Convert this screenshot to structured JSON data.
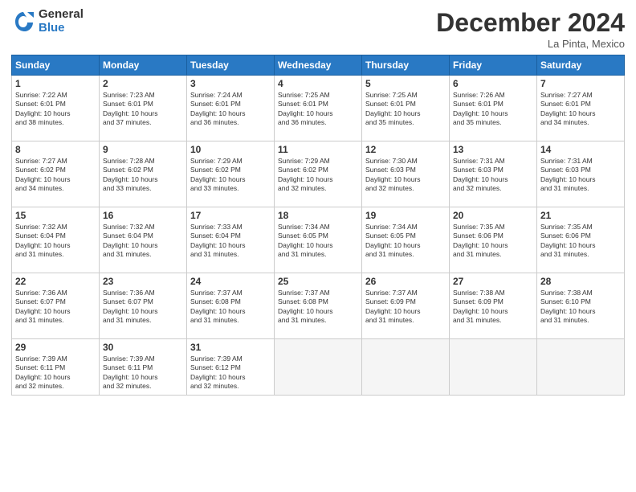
{
  "logo": {
    "general": "General",
    "blue": "Blue"
  },
  "title": "December 2024",
  "location": "La Pinta, Mexico",
  "weekdays": [
    "Sunday",
    "Monday",
    "Tuesday",
    "Wednesday",
    "Thursday",
    "Friday",
    "Saturday"
  ],
  "weeks": [
    [
      {
        "day": "1",
        "info": "Sunrise: 7:22 AM\nSunset: 6:01 PM\nDaylight: 10 hours\nand 38 minutes."
      },
      {
        "day": "2",
        "info": "Sunrise: 7:23 AM\nSunset: 6:01 PM\nDaylight: 10 hours\nand 37 minutes."
      },
      {
        "day": "3",
        "info": "Sunrise: 7:24 AM\nSunset: 6:01 PM\nDaylight: 10 hours\nand 36 minutes."
      },
      {
        "day": "4",
        "info": "Sunrise: 7:25 AM\nSunset: 6:01 PM\nDaylight: 10 hours\nand 36 minutes."
      },
      {
        "day": "5",
        "info": "Sunrise: 7:25 AM\nSunset: 6:01 PM\nDaylight: 10 hours\nand 35 minutes."
      },
      {
        "day": "6",
        "info": "Sunrise: 7:26 AM\nSunset: 6:01 PM\nDaylight: 10 hours\nand 35 minutes."
      },
      {
        "day": "7",
        "info": "Sunrise: 7:27 AM\nSunset: 6:01 PM\nDaylight: 10 hours\nand 34 minutes."
      }
    ],
    [
      {
        "day": "8",
        "info": "Sunrise: 7:27 AM\nSunset: 6:02 PM\nDaylight: 10 hours\nand 34 minutes."
      },
      {
        "day": "9",
        "info": "Sunrise: 7:28 AM\nSunset: 6:02 PM\nDaylight: 10 hours\nand 33 minutes."
      },
      {
        "day": "10",
        "info": "Sunrise: 7:29 AM\nSunset: 6:02 PM\nDaylight: 10 hours\nand 33 minutes."
      },
      {
        "day": "11",
        "info": "Sunrise: 7:29 AM\nSunset: 6:02 PM\nDaylight: 10 hours\nand 32 minutes."
      },
      {
        "day": "12",
        "info": "Sunrise: 7:30 AM\nSunset: 6:03 PM\nDaylight: 10 hours\nand 32 minutes."
      },
      {
        "day": "13",
        "info": "Sunrise: 7:31 AM\nSunset: 6:03 PM\nDaylight: 10 hours\nand 32 minutes."
      },
      {
        "day": "14",
        "info": "Sunrise: 7:31 AM\nSunset: 6:03 PM\nDaylight: 10 hours\nand 31 minutes."
      }
    ],
    [
      {
        "day": "15",
        "info": "Sunrise: 7:32 AM\nSunset: 6:04 PM\nDaylight: 10 hours\nand 31 minutes."
      },
      {
        "day": "16",
        "info": "Sunrise: 7:32 AM\nSunset: 6:04 PM\nDaylight: 10 hours\nand 31 minutes."
      },
      {
        "day": "17",
        "info": "Sunrise: 7:33 AM\nSunset: 6:04 PM\nDaylight: 10 hours\nand 31 minutes."
      },
      {
        "day": "18",
        "info": "Sunrise: 7:34 AM\nSunset: 6:05 PM\nDaylight: 10 hours\nand 31 minutes."
      },
      {
        "day": "19",
        "info": "Sunrise: 7:34 AM\nSunset: 6:05 PM\nDaylight: 10 hours\nand 31 minutes."
      },
      {
        "day": "20",
        "info": "Sunrise: 7:35 AM\nSunset: 6:06 PM\nDaylight: 10 hours\nand 31 minutes."
      },
      {
        "day": "21",
        "info": "Sunrise: 7:35 AM\nSunset: 6:06 PM\nDaylight: 10 hours\nand 31 minutes."
      }
    ],
    [
      {
        "day": "22",
        "info": "Sunrise: 7:36 AM\nSunset: 6:07 PM\nDaylight: 10 hours\nand 31 minutes."
      },
      {
        "day": "23",
        "info": "Sunrise: 7:36 AM\nSunset: 6:07 PM\nDaylight: 10 hours\nand 31 minutes."
      },
      {
        "day": "24",
        "info": "Sunrise: 7:37 AM\nSunset: 6:08 PM\nDaylight: 10 hours\nand 31 minutes."
      },
      {
        "day": "25",
        "info": "Sunrise: 7:37 AM\nSunset: 6:08 PM\nDaylight: 10 hours\nand 31 minutes."
      },
      {
        "day": "26",
        "info": "Sunrise: 7:37 AM\nSunset: 6:09 PM\nDaylight: 10 hours\nand 31 minutes."
      },
      {
        "day": "27",
        "info": "Sunrise: 7:38 AM\nSunset: 6:09 PM\nDaylight: 10 hours\nand 31 minutes."
      },
      {
        "day": "28",
        "info": "Sunrise: 7:38 AM\nSunset: 6:10 PM\nDaylight: 10 hours\nand 31 minutes."
      }
    ],
    [
      {
        "day": "29",
        "info": "Sunrise: 7:39 AM\nSunset: 6:11 PM\nDaylight: 10 hours\nand 32 minutes."
      },
      {
        "day": "30",
        "info": "Sunrise: 7:39 AM\nSunset: 6:11 PM\nDaylight: 10 hours\nand 32 minutes."
      },
      {
        "day": "31",
        "info": "Sunrise: 7:39 AM\nSunset: 6:12 PM\nDaylight: 10 hours\nand 32 minutes."
      },
      {
        "day": "",
        "info": ""
      },
      {
        "day": "",
        "info": ""
      },
      {
        "day": "",
        "info": ""
      },
      {
        "day": "",
        "info": ""
      }
    ]
  ]
}
